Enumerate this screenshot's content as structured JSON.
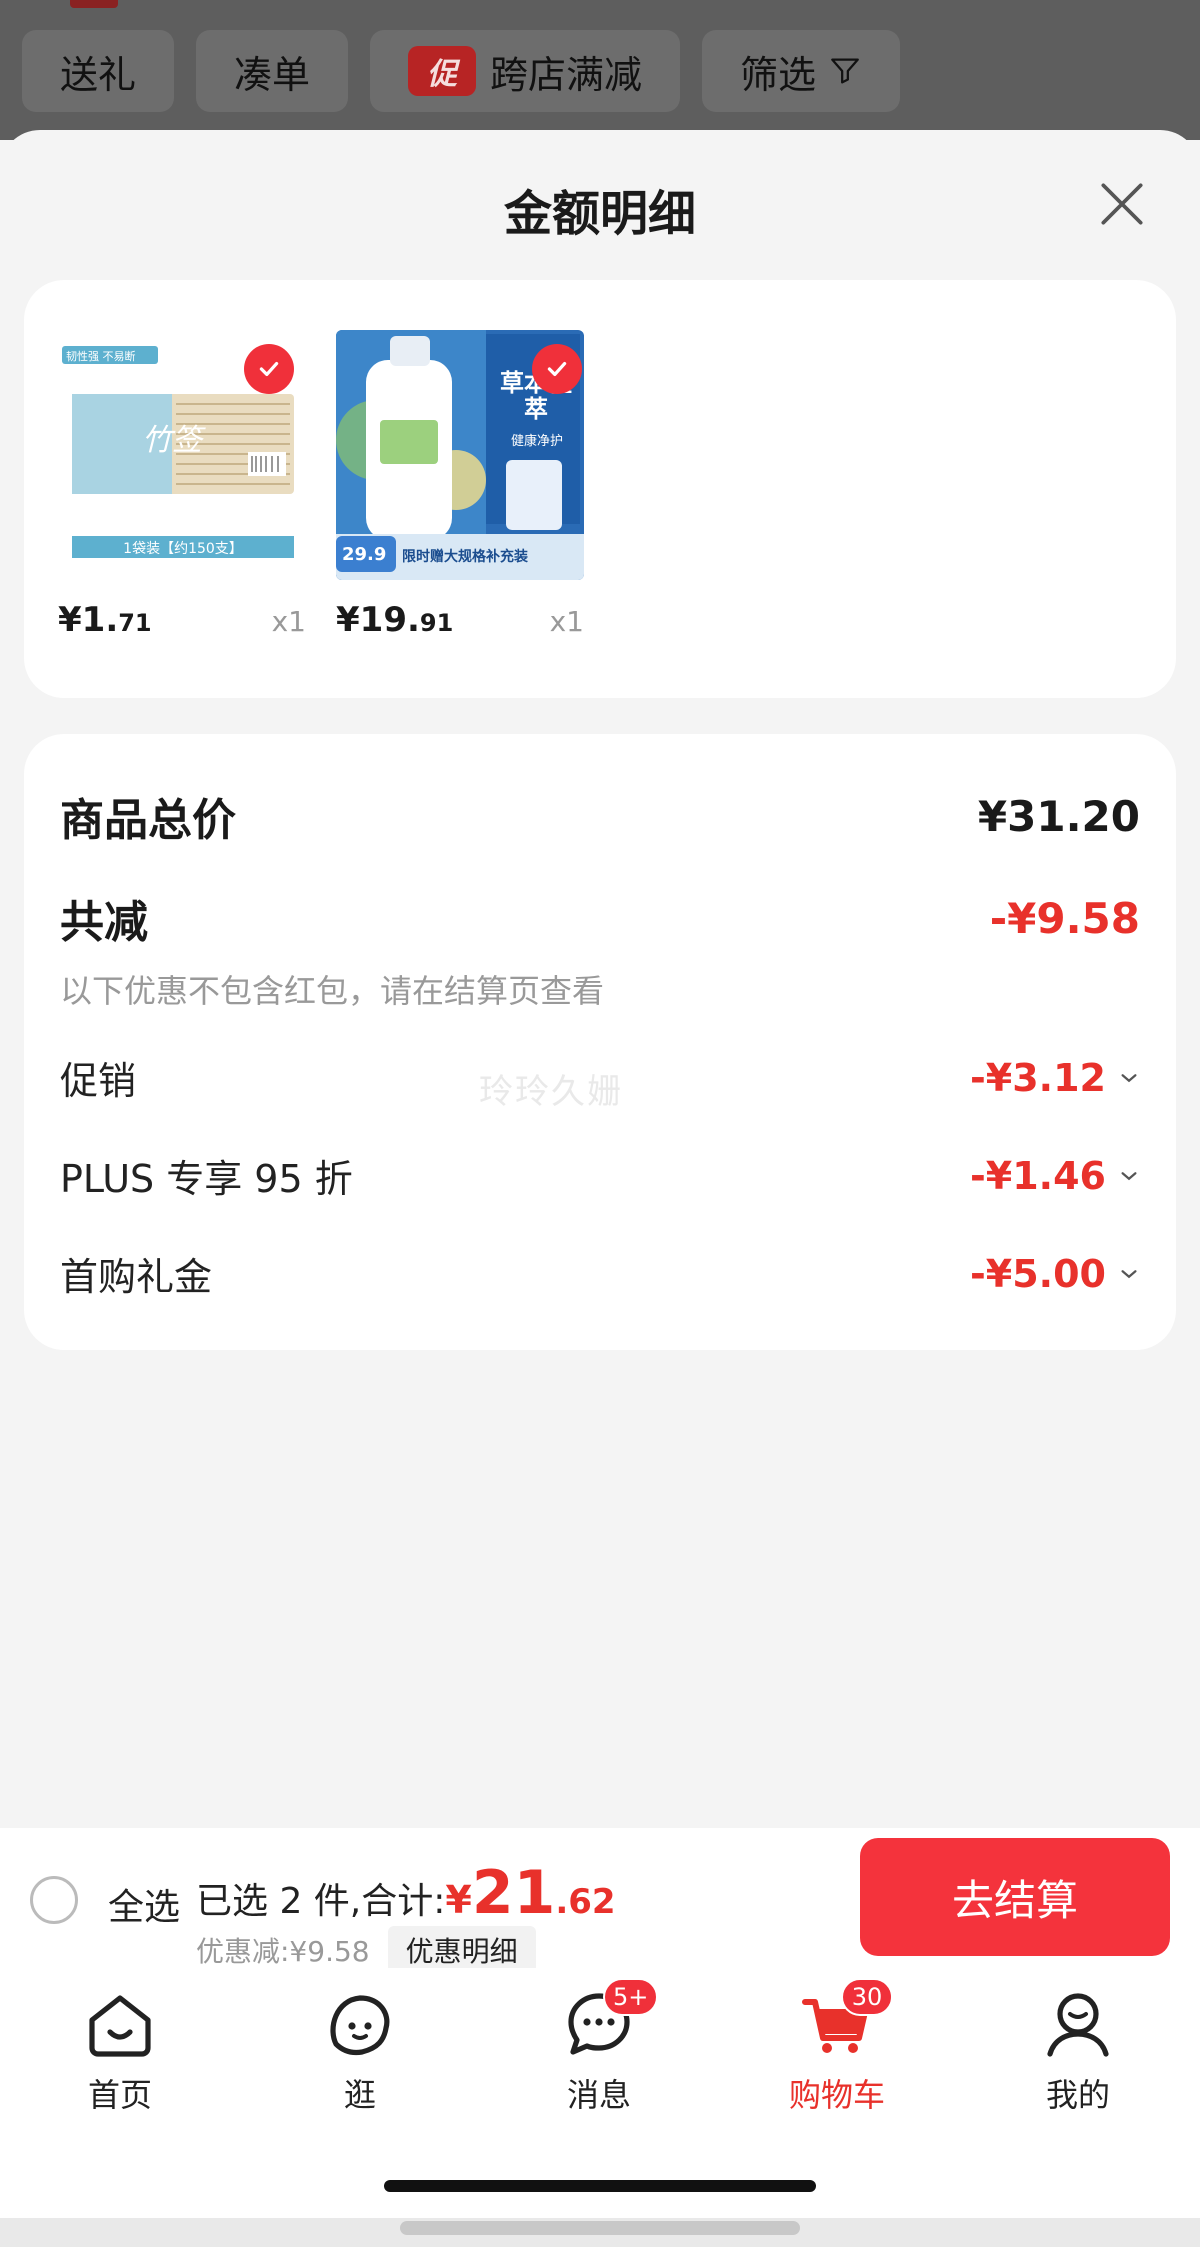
{
  "filters": {
    "items": [
      "送礼",
      "凑单",
      "跨店满减",
      "筛选"
    ],
    "promo_tag": "促"
  },
  "sheet": {
    "title": "金额明细"
  },
  "products": [
    {
      "banner": "韧性强 不易断",
      "label": "1袋装【约150支】",
      "price_int": "¥1.",
      "price_dec": "71",
      "qty": "x1"
    },
    {
      "price_tag": "29.9",
      "promo_text": "限时赠大规格补充装",
      "side_text": "草本植萃",
      "side_sub": "健康净护",
      "price_int": "¥19.",
      "price_dec": "91",
      "qty": "x1"
    }
  ],
  "summary": {
    "total_label": "商品总价",
    "total_value": "¥31.20",
    "reduce_label": "共减",
    "reduce_value": "-¥9.58",
    "note": "以下优惠不包含红包，请在结算页查看",
    "watermark": "玲玲久姗",
    "lines": [
      {
        "label": "促销",
        "value": "-¥3.12"
      },
      {
        "label": "PLUS 专享 95 折",
        "value": "-¥1.46"
      },
      {
        "label": "首购礼金",
        "value": "-¥5.00"
      }
    ]
  },
  "checkout": {
    "select_all": "全选",
    "selected_text": "已选 2 件,合计:",
    "yen": "¥",
    "total_int": "21",
    "total_dec": ".62",
    "discount_text": "优惠减:¥9.58",
    "detail_button": "优惠明细",
    "checkout_button": "去结算"
  },
  "tabbar": {
    "items": [
      {
        "label": "首页",
        "icon": "home-icon"
      },
      {
        "label": "逛",
        "icon": "browse-face-icon"
      },
      {
        "label": "消息",
        "icon": "message-icon",
        "badge": "5+"
      },
      {
        "label": "购物车",
        "icon": "cart-icon",
        "badge": "30",
        "active": true
      },
      {
        "label": "我的",
        "icon": "profile-icon"
      }
    ]
  },
  "colors": {
    "accent": "#e8312b",
    "button": "#f4333c",
    "background": "#f4f4f4"
  }
}
